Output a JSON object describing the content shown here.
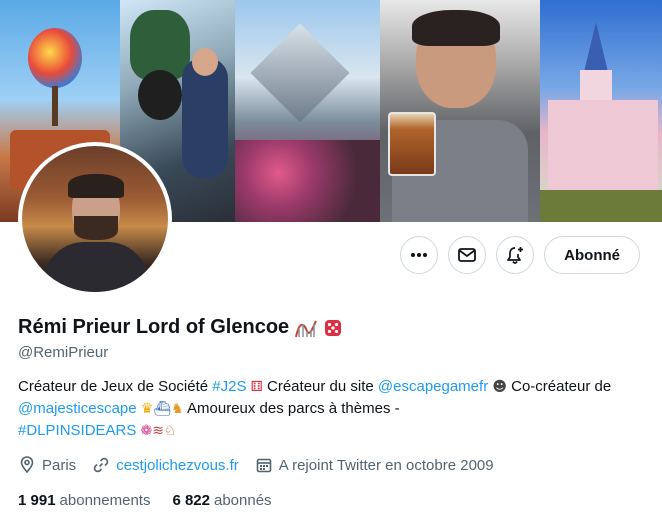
{
  "profile": {
    "name": "Rémi Prieur Lord of Glencoe",
    "handle": "@RemiPrieur",
    "follow_label": "Abonné"
  },
  "bio": {
    "t1": "Créateur de Jeux de Société ",
    "hashtag1": "#J2S",
    "t2": " Créateur du site ",
    "mention1": "@escapegamefr",
    "t3": " Co-créateur de ",
    "mention2": "@majesticescape",
    "t4": " Amoureux des parcs à thèmes - ",
    "hashtag2": "#DLPINSIDEARS"
  },
  "meta": {
    "location": "Paris",
    "website": "cestjolichezvous.fr",
    "joined": "A rejoint Twitter en octobre 2009"
  },
  "stats": {
    "following_count": "1 991",
    "following_label": "abonnements",
    "followers_count": "6 822",
    "followers_label": "abonnés"
  },
  "icons": {
    "more": "more-icon",
    "message": "mail-icon",
    "notify": "bell-plus-icon",
    "location": "location-pin-icon",
    "website": "link-icon",
    "joined": "calendar-icon"
  },
  "colors": {
    "accent": "#1d9bf0",
    "secondary_text": "#536471",
    "border": "#cfd9de"
  }
}
